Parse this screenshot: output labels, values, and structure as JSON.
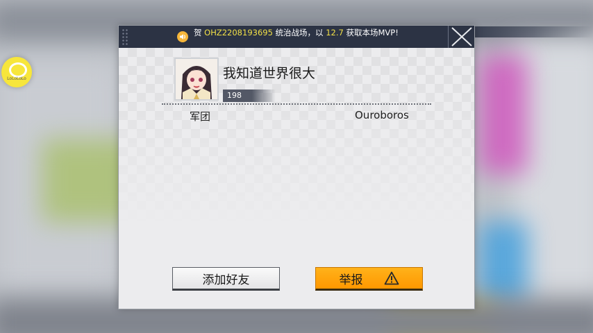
{
  "broadcast": {
    "prefix": "贺",
    "player_id": "OHZ2208193695",
    "mid": "统治战场，以",
    "score": "12.7",
    "suffix": "获取本场MVP!"
  },
  "side_logo_text": "LoLoLoLo",
  "profile": {
    "name": "我知道世界很大",
    "level": "198",
    "legion_label": "军团",
    "legion_value": "Ouroboros"
  },
  "buttons": {
    "add_friend": "添加好友",
    "report": "举报"
  },
  "colors": {
    "bar_bg": "#2c3344",
    "highlight": "#f2e047",
    "report_button": "#ff9f00"
  },
  "icons": [
    "speaker-icon",
    "close-icon",
    "warning-icon",
    "avatar"
  ]
}
